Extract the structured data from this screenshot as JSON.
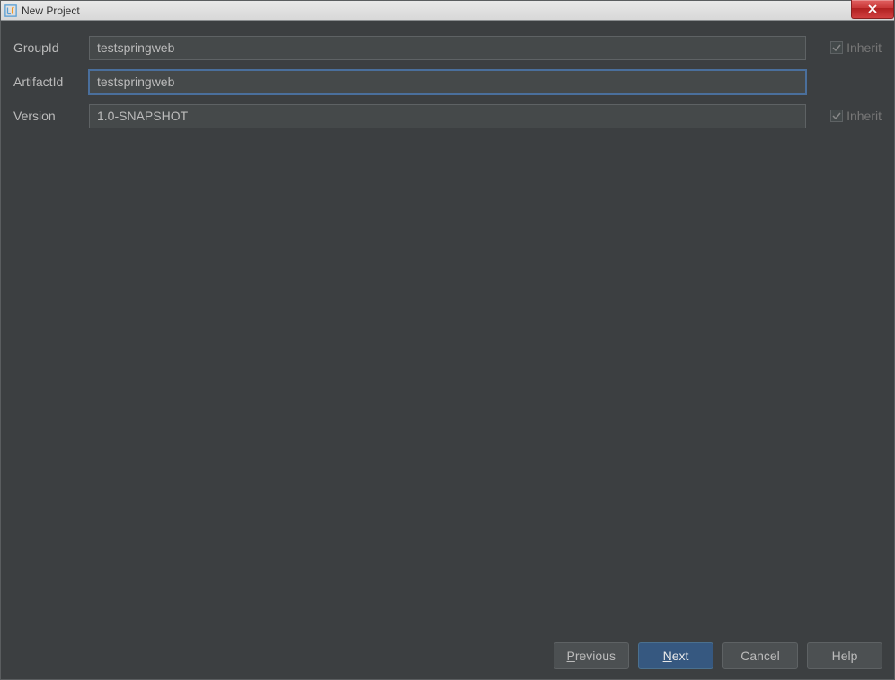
{
  "title": "New Project",
  "fields": {
    "groupId": {
      "label": "GroupId",
      "value": "testspringweb",
      "inherit_label": "Inherit"
    },
    "artifactId": {
      "label": "ArtifactId",
      "value": "testspringweb"
    },
    "version": {
      "label": "Version",
      "value": "1.0-SNAPSHOT",
      "inherit_label": "Inherit"
    }
  },
  "buttons": {
    "previous_prefix": "P",
    "previous_rest": "revious",
    "next_prefix": "N",
    "next_rest": "ext",
    "cancel": "Cancel",
    "help": "Help"
  }
}
